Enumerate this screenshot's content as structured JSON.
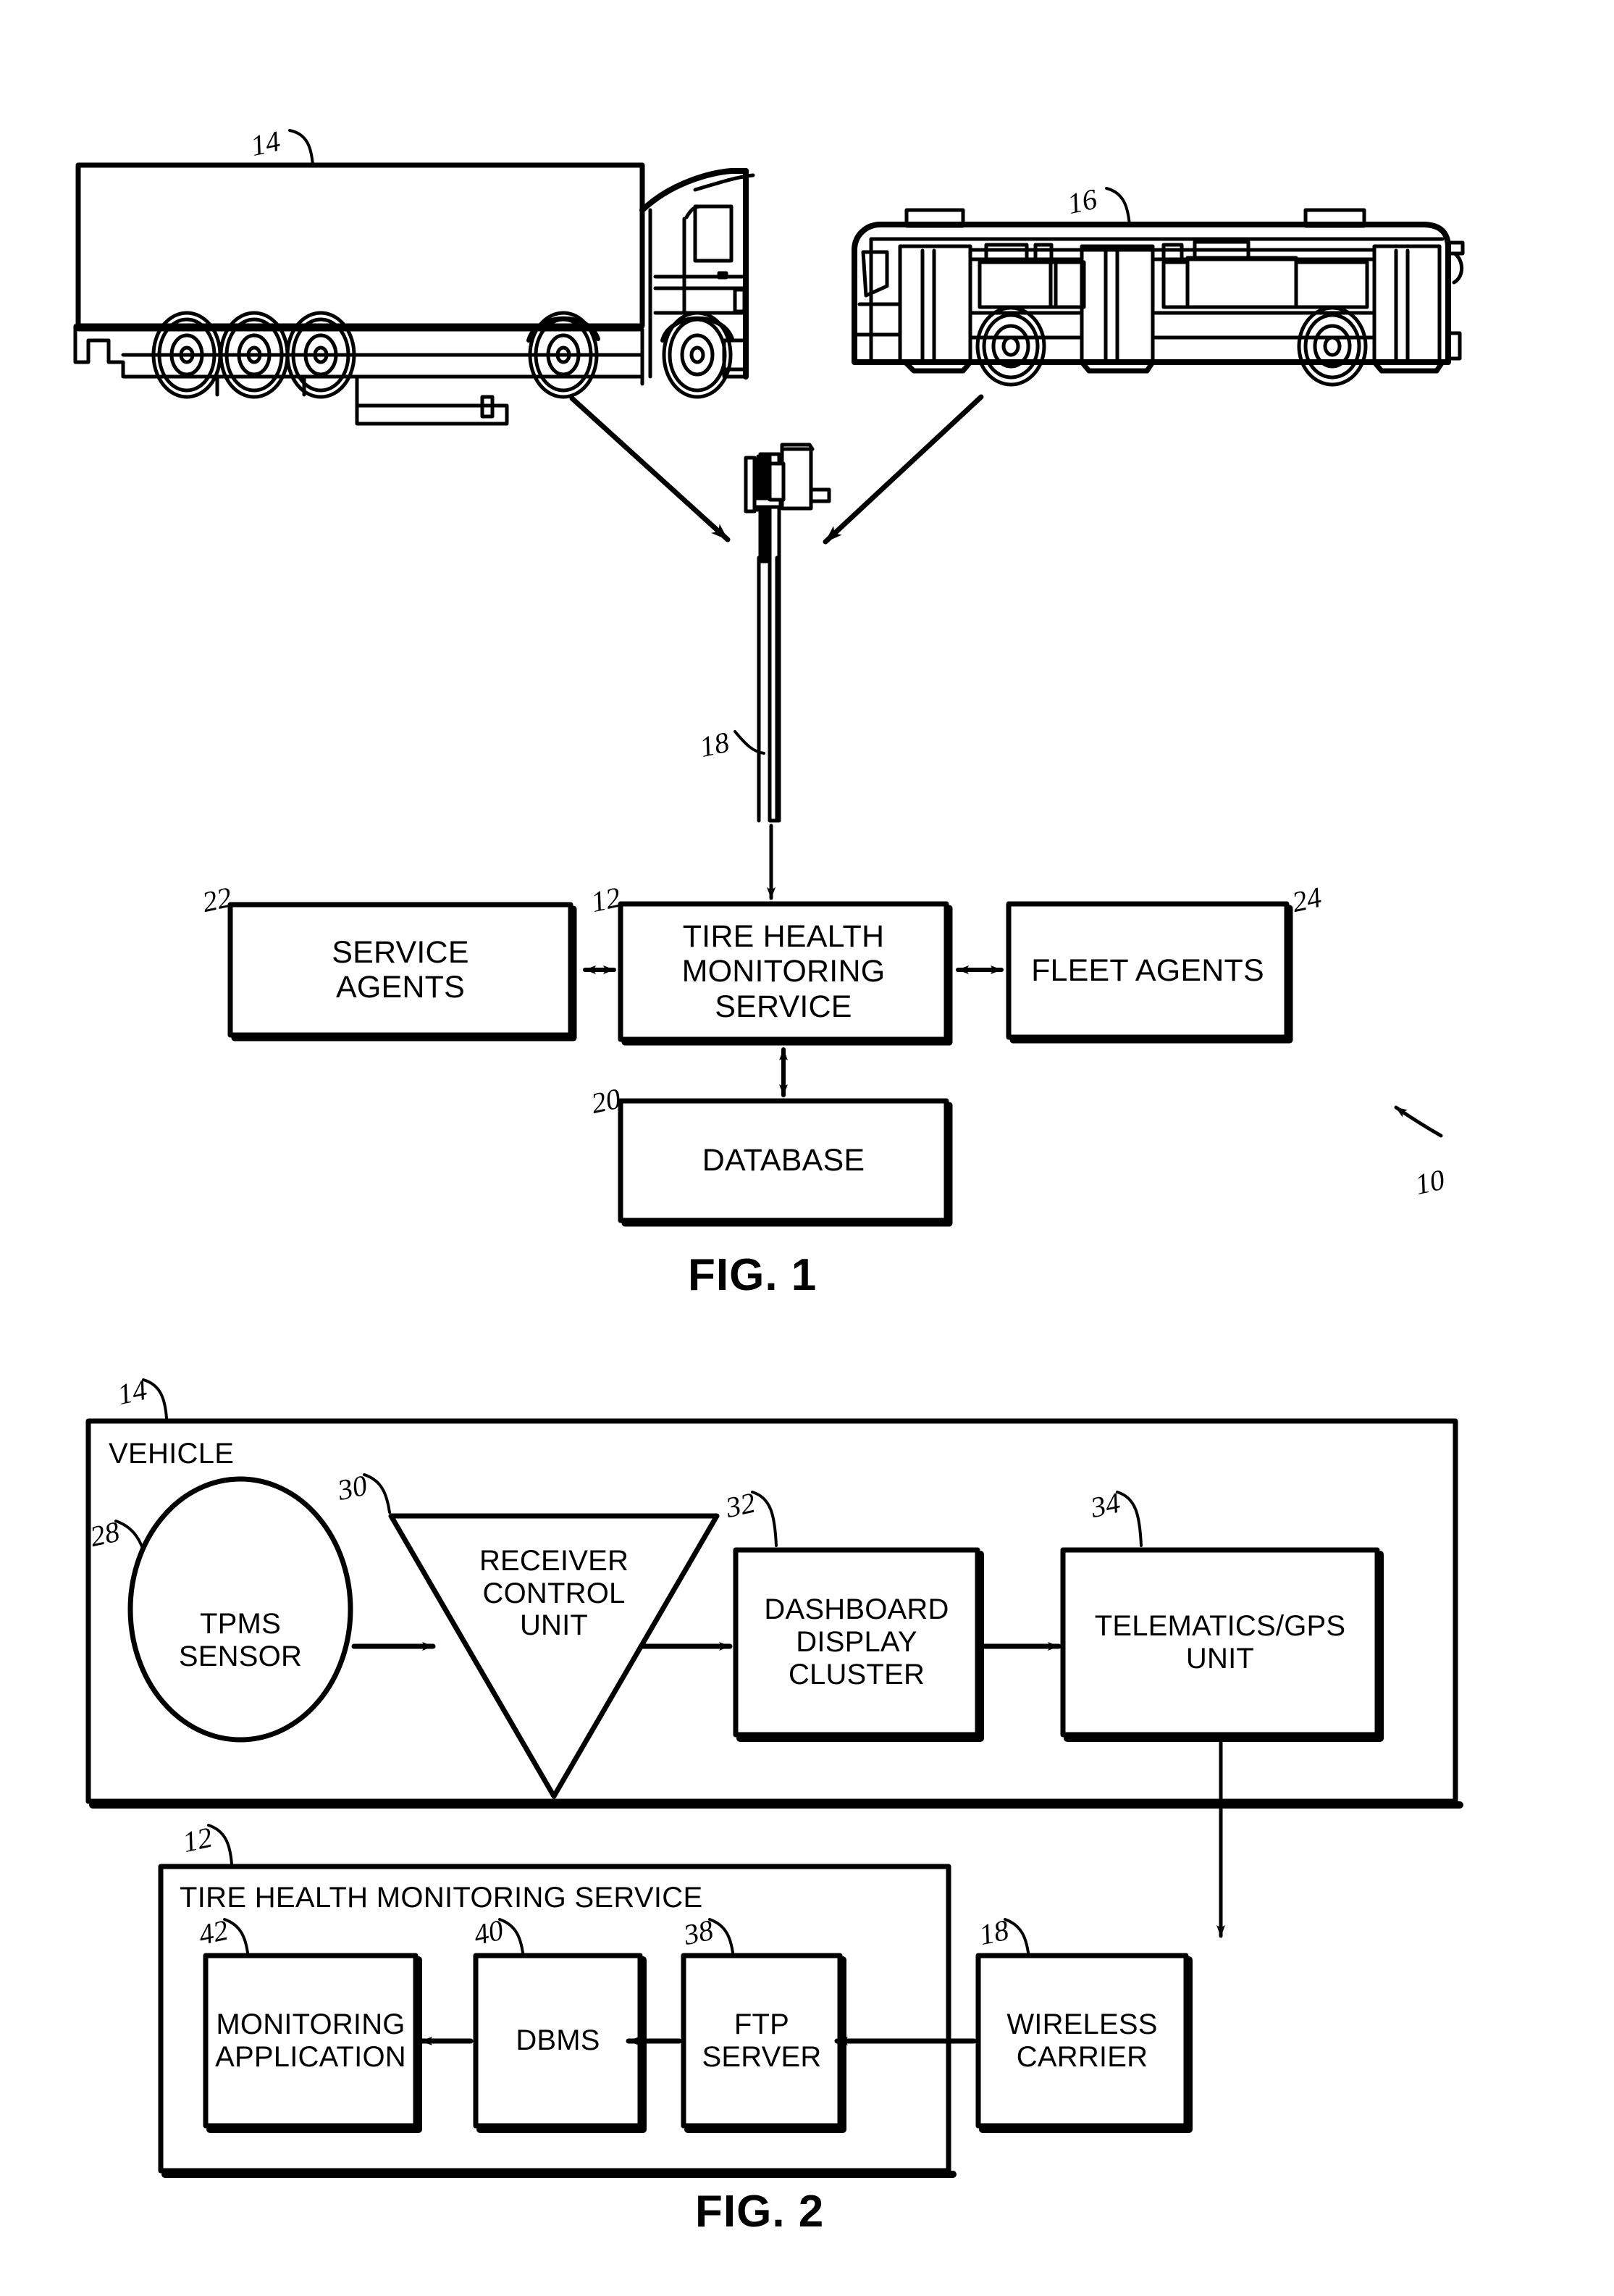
{
  "figure1": {
    "caption": "FIG. 1",
    "system_ref": "10",
    "illustrations": [
      {
        "name": "truck",
        "ref": "14"
      },
      {
        "name": "bus",
        "ref": "16"
      },
      {
        "name": "cell-tower",
        "ref": "18"
      }
    ],
    "boxes": [
      {
        "id": "service-agents",
        "label": "SERVICE\nAGENTS",
        "ref": "22"
      },
      {
        "id": "tire-health-monitoring-service",
        "label": "TIRE HEALTH\nMONITORING\nSERVICE",
        "ref": "12"
      },
      {
        "id": "fleet-agents",
        "label": "FLEET AGENTS",
        "ref": "24"
      },
      {
        "id": "database",
        "label": "DATABASE",
        "ref": "20"
      }
    ],
    "connections": [
      {
        "from": "truck",
        "to": "cell-tower",
        "style": "single-arrow"
      },
      {
        "from": "bus",
        "to": "cell-tower",
        "style": "single-arrow"
      },
      {
        "from": "cell-tower",
        "to": "tire-health-monitoring-service",
        "style": "single-arrow"
      },
      {
        "from": "service-agents",
        "to": "tire-health-monitoring-service",
        "style": "double-arrow"
      },
      {
        "from": "tire-health-monitoring-service",
        "to": "fleet-agents",
        "style": "double-arrow"
      },
      {
        "from": "tire-health-monitoring-service",
        "to": "database",
        "style": "double-arrow"
      }
    ]
  },
  "figure2": {
    "caption": "FIG. 2",
    "vehicle_group": {
      "title": "VEHICLE",
      "ref": "14"
    },
    "service_group": {
      "title": "TIRE HEALTH MONITORING SERVICE",
      "ref": "12"
    },
    "boxes": [
      {
        "id": "tpms-sensor",
        "label": "TPMS\nSENSOR",
        "ref": "28",
        "shape": "ellipse"
      },
      {
        "id": "receiver-control-unit",
        "label": "RECEIVER\nCONTROL\nUNIT",
        "ref": "30",
        "shape": "triangle"
      },
      {
        "id": "dashboard-display-cluster",
        "label": "DASHBOARD\nDISPLAY\nCLUSTER",
        "ref": "32",
        "shape": "rect"
      },
      {
        "id": "telematics-gps-unit",
        "label": "TELEMATICS/GPS\nUNIT",
        "ref": "34",
        "shape": "rect"
      },
      {
        "id": "wireless-carrier",
        "label": "WIRELESS\nCARRIER",
        "ref": "18",
        "shape": "rect"
      },
      {
        "id": "ftp-server",
        "label": "FTP\nSERVER",
        "ref": "38",
        "shape": "rect"
      },
      {
        "id": "dbms",
        "label": "DBMS",
        "ref": "40",
        "shape": "rect"
      },
      {
        "id": "monitoring-application",
        "label": "MONITORING\nAPPLICATION",
        "ref": "42",
        "shape": "rect"
      }
    ],
    "connections": [
      {
        "from": "tpms-sensor",
        "to": "receiver-control-unit",
        "style": "single-arrow"
      },
      {
        "from": "receiver-control-unit",
        "to": "dashboard-display-cluster",
        "style": "single-arrow"
      },
      {
        "from": "dashboard-display-cluster",
        "to": "telematics-gps-unit",
        "style": "single-arrow"
      },
      {
        "from": "telematics-gps-unit",
        "to": "wireless-carrier",
        "style": "single-arrow"
      },
      {
        "from": "wireless-carrier",
        "to": "ftp-server",
        "style": "single-arrow"
      },
      {
        "from": "ftp-server",
        "to": "dbms",
        "style": "single-arrow"
      },
      {
        "from": "dbms",
        "to": "monitoring-application",
        "style": "single-arrow"
      }
    ]
  },
  "colors": {
    "ink": "#000000",
    "paper": "#ffffff"
  }
}
